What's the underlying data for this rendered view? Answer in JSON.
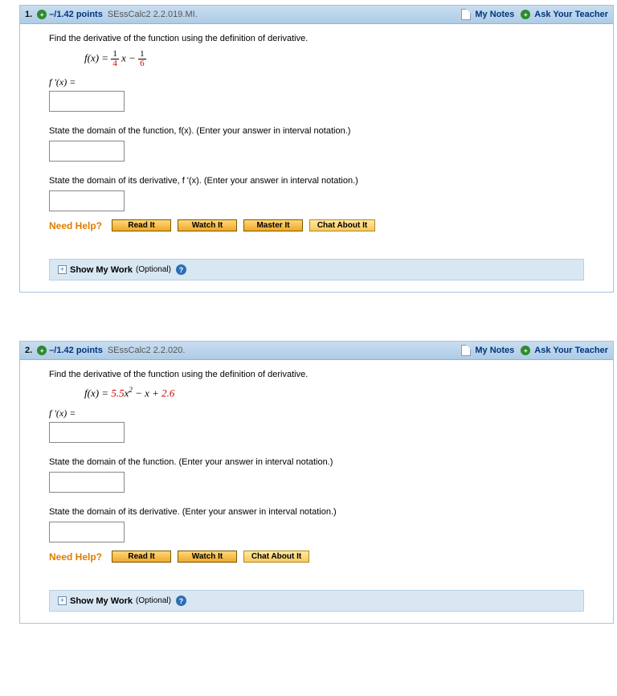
{
  "hdr": {
    "my_notes": "My Notes",
    "ask_teacher": "Ask Your Teacher"
  },
  "need_help_label": "Need Help?",
  "help_buttons": {
    "read": "Read It",
    "watch": "Watch It",
    "master": "Master It",
    "chat": "Chat About It"
  },
  "show_work": {
    "title": "Show My Work",
    "optional": "(Optional)"
  },
  "q1": {
    "num": "1.",
    "points": "–/1.42 points",
    "source": "SEssCalc2 2.2.019.MI.",
    "prompt": "Find the derivative of the function using the definition of derivative.",
    "eq_prefix": "f(x) = ",
    "frac1_num": "1",
    "frac1_den": "4",
    "mid": "x − ",
    "frac2_num": "1",
    "frac2_den": "6",
    "fprime_label": "f '(x) =",
    "domain_fx": "State the domain of the function, f(x). (Enter your answer in interval notation.)",
    "domain_fpx": "State the domain of its derivative, f '(x). (Enter your answer in interval notation.)"
  },
  "q2": {
    "num": "2.",
    "points": "–/1.42 points",
    "source": "SEssCalc2 2.2.020.",
    "prompt": "Find the derivative of the function using the definition of derivative.",
    "eq_prefix": "f(x) = ",
    "coef": "5.5",
    "mid": "x",
    "sup": "2",
    "after": " − x + ",
    "const": "2.6",
    "fprime_label": "f '(x) =",
    "domain_fx": "State the domain of the function. (Enter your answer in interval notation.)",
    "domain_fpx": "State the domain of its derivative. (Enter your answer in interval notation.)"
  }
}
